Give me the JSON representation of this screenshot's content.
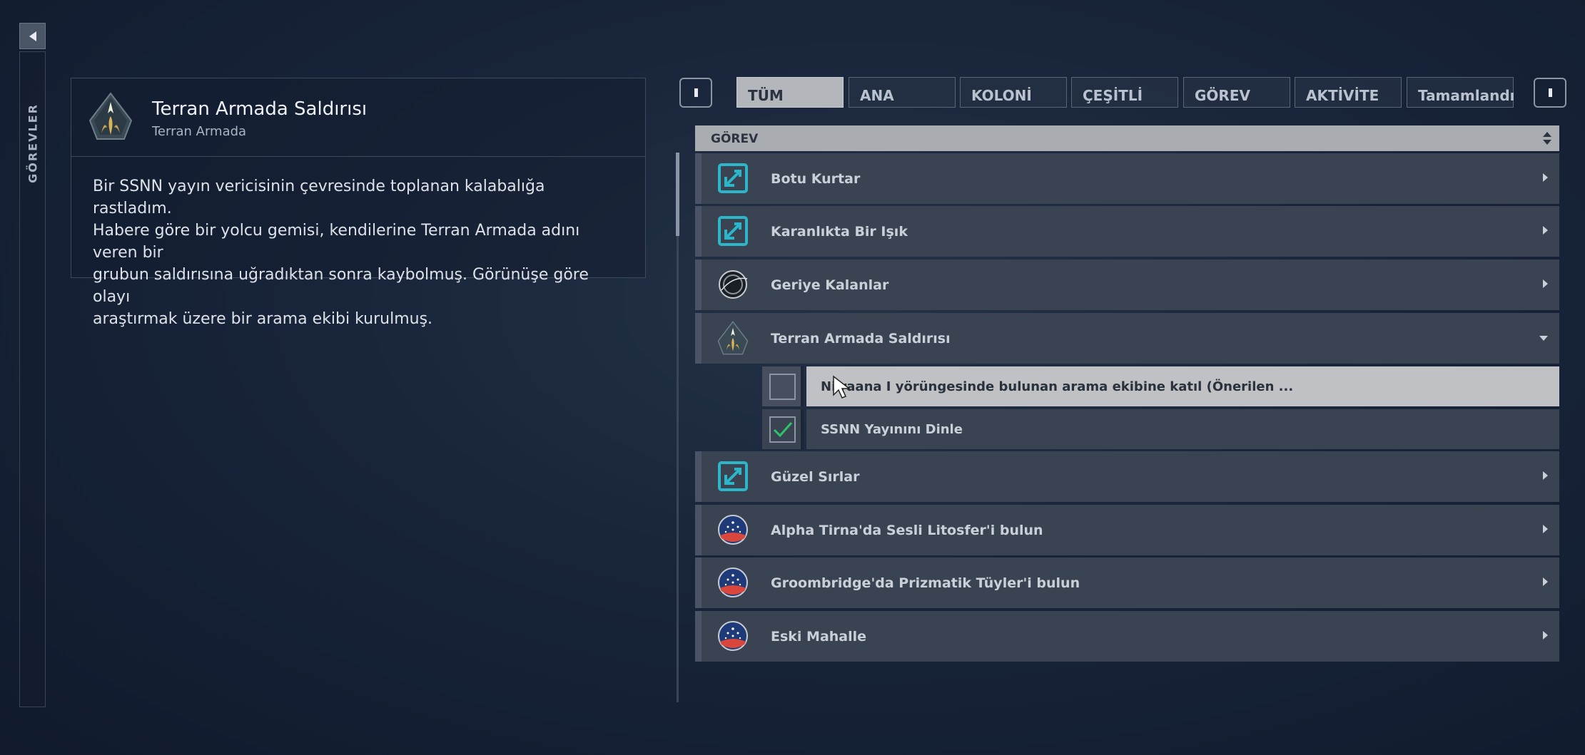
{
  "sidebar": {
    "toggle_icon": "caret-left-icon",
    "label": "GÖREVLER"
  },
  "detail": {
    "icon": "terran-armada-emblem-icon",
    "title": "Terran Armada Saldırısı",
    "subtitle": "Terran Armada",
    "description_lines": [
      "Bir SSNN yayın vericisinin çevresinde toplanan kalabalığa rastladım.",
      "Habere göre bir yolcu gemisi, kendilerine Terran Armada adını veren bir",
      "grubun saldırısına uğradıktan sonra kaybolmuş. Görünüşe göre olayı",
      "araştırmak üzere bir arama ekibi kurulmuş."
    ]
  },
  "tabs": [
    {
      "label": "TÜM",
      "active": true
    },
    {
      "label": "ANA",
      "active": false
    },
    {
      "label": "KOLONİ",
      "active": false
    },
    {
      "label": "ÇEŞİTLİ",
      "active": false
    },
    {
      "label": "GÖREV",
      "active": false
    },
    {
      "label": "AKTİVİTE",
      "active": false
    },
    {
      "label": "Tamamlandı",
      "active": false
    }
  ],
  "list_header": {
    "label": "GÖREV",
    "sort_icon": "sort-updown-icon"
  },
  "quests": [
    {
      "label": "Botu Kurtar",
      "icon": "mission-board-icon",
      "expanded": false
    },
    {
      "label": "Karanlıkta Bir Işık",
      "icon": "mission-board-icon",
      "expanded": false
    },
    {
      "label": "Geriye Kalanlar",
      "icon": "constellation-ring-icon",
      "expanded": false
    },
    {
      "label": "Terran Armada Saldırısı",
      "icon": "terran-armada-emblem-icon",
      "expanded": true
    },
    {
      "label": "Güzel Sırlar",
      "icon": "mission-board-icon",
      "expanded": false
    },
    {
      "label": "Alpha Tirna'da Sesli Litosfer'i bulun",
      "icon": "planet-globe-icon",
      "expanded": false
    },
    {
      "label": "Groombridge'da Prizmatik Tüyler'i bulun",
      "icon": "planet-globe-icon",
      "expanded": false
    },
    {
      "label": "Eski Mahalle",
      "icon": "planet-globe-icon",
      "expanded": false
    }
  ],
  "objectives": [
    {
      "label": "Niiraana I yörüngesinde bulunan arama ekibine katıl (Önerilen ...",
      "done": false,
      "selected": true
    },
    {
      "label": "SSNN Yayınını Dinle",
      "done": true,
      "selected": false
    }
  ],
  "colors": {
    "mission_board_cyan": "#2bb7c9",
    "check_green": "#2ec46a",
    "armada_gold": "#c9a14a"
  }
}
